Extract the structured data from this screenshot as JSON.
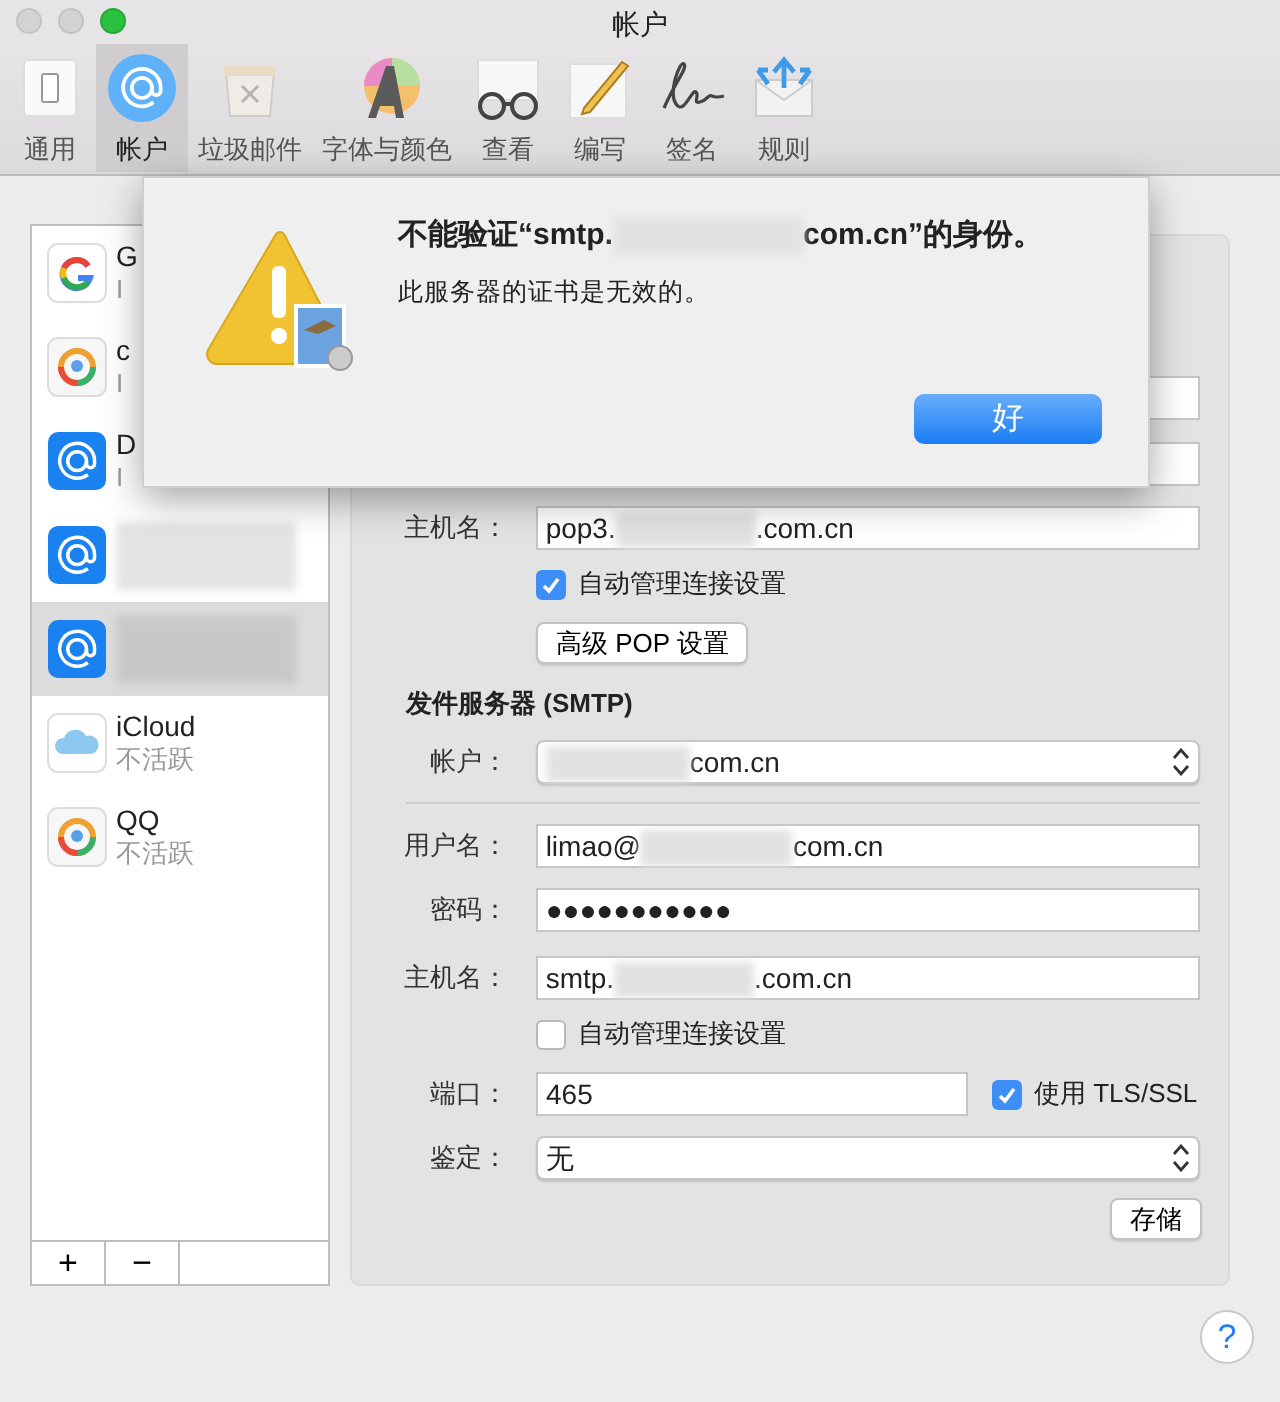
{
  "window": {
    "title": "帐户"
  },
  "toolbar": [
    {
      "kind": "general",
      "label": "通用",
      "selected": false
    },
    {
      "kind": "accounts",
      "label": "帐户",
      "selected": true
    },
    {
      "kind": "junk",
      "label": "垃圾邮件",
      "selected": false
    },
    {
      "kind": "fonts",
      "label": "字体与颜色",
      "selected": false
    },
    {
      "kind": "viewing",
      "label": "查看",
      "selected": false
    },
    {
      "kind": "composing",
      "label": "编写",
      "selected": false
    },
    {
      "kind": "signatures",
      "label": "签名",
      "selected": false
    },
    {
      "kind": "rules",
      "label": "规则",
      "selected": false
    }
  ],
  "accounts": [
    {
      "kind": "google",
      "name": "G",
      "subtitle": "I",
      "selected": false
    },
    {
      "kind": "ring",
      "name": "c",
      "subtitle": "I",
      "selected": false
    },
    {
      "kind": "at",
      "name": "D",
      "subtitle": "I",
      "selected": false
    },
    {
      "kind": "at",
      "redacted": true,
      "selected": false
    },
    {
      "kind": "at",
      "redacted": true,
      "selected": true
    },
    {
      "kind": "icloud",
      "name": "iCloud",
      "subtitle": "不活跃",
      "selected": false
    },
    {
      "kind": "ring",
      "name": "QQ",
      "subtitle": "不活跃",
      "selected": false
    }
  ],
  "account_buttons": [
    "+",
    "−"
  ],
  "incoming": {
    "host": {
      "label": "主机名：",
      "before": "pop3.",
      "after": ".com.cn"
    },
    "auto_manage": {
      "label": "自动管理连接设置",
      "checked": true
    },
    "advanced_button": "高级 POP 设置"
  },
  "outgoing": {
    "heading": "发件服务器 (SMTP)",
    "account": {
      "label": "帐户：",
      "after": "com.cn"
    },
    "username": {
      "label": "用户名：",
      "before": "limao@",
      "after": "com.cn"
    },
    "password": {
      "label": "密码：",
      "value": "●●●●●●●●●●●"
    },
    "host": {
      "label": "主机名：",
      "before": "smtp.",
      "after": ".com.cn"
    },
    "auto_manage": {
      "label": "自动管理连接设置",
      "checked": false
    },
    "port": {
      "label": "端口：",
      "value": "465"
    },
    "tls": {
      "label": "使用 TLS/SSL",
      "checked": true
    },
    "auth": {
      "label": "鉴定：",
      "value": "无"
    },
    "save_button": "存储"
  },
  "help_button": "?",
  "alert": {
    "title_before": "不能验证“smtp.",
    "title_after": "com.cn”的身份。",
    "message": "此服务器的证书是无效的。",
    "button": "好"
  }
}
